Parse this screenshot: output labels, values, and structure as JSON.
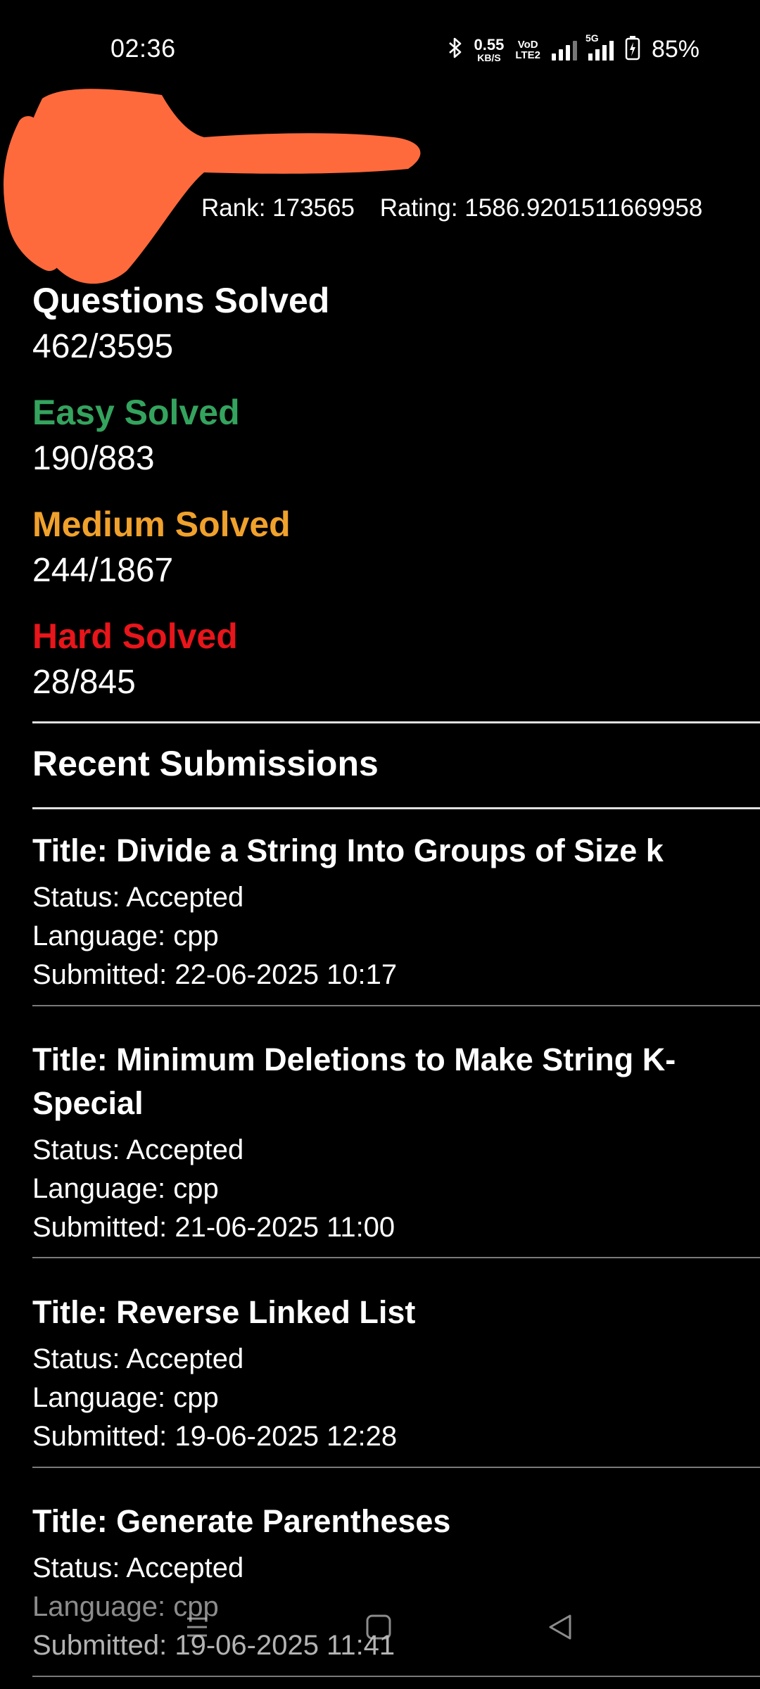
{
  "status_bar": {
    "time": "02:36",
    "net_speed_value": "0.55",
    "net_speed_unit": "KB/S",
    "volte_top": "VoD",
    "volte_bottom": "LTE2",
    "five_g_label": "5G",
    "battery_percent": "85%",
    "icons": [
      "bluetooth-icon",
      "signal-icon",
      "battery-icon"
    ]
  },
  "profile": {
    "rank_text": "Rank: 173565",
    "rating_text": "Rating: 1586.9201511669958",
    "redaction_color": "#ff6a3d"
  },
  "stats": {
    "total": {
      "label": "Questions Solved",
      "value": "462/3595"
    },
    "easy": {
      "label": "Easy Solved",
      "value": "190/883",
      "color": "#34a35e"
    },
    "medium": {
      "label": "Medium Solved",
      "value": "244/1867",
      "color": "#f0a12c"
    },
    "hard": {
      "label": "Hard Solved",
      "value": "28/845",
      "color": "#e8151a"
    }
  },
  "recent": {
    "heading": "Recent Submissions",
    "items": [
      {
        "title": "Title: Divide a String Into Groups of Size k",
        "status": "Status: Accepted",
        "language": "Language: cpp",
        "submitted": "Submitted: 22-06-2025 10:17"
      },
      {
        "title": "Title: Minimum Deletions to Make String K-Special",
        "status": "Status: Accepted",
        "language": "Language: cpp",
        "submitted": "Submitted: 21-06-2025 11:00"
      },
      {
        "title": "Title: Reverse Linked List",
        "status": "Status: Accepted",
        "language": "Language: cpp",
        "submitted": "Submitted: 19-06-2025 12:28"
      },
      {
        "title": "Title: Generate Parentheses",
        "status": "Status: Accepted",
        "language": "Language: cpp",
        "submitted": "Submitted: 19-06-2025 11:41"
      }
    ]
  },
  "navbar": {
    "icons": [
      "recents-icon",
      "home-icon",
      "back-icon"
    ]
  }
}
